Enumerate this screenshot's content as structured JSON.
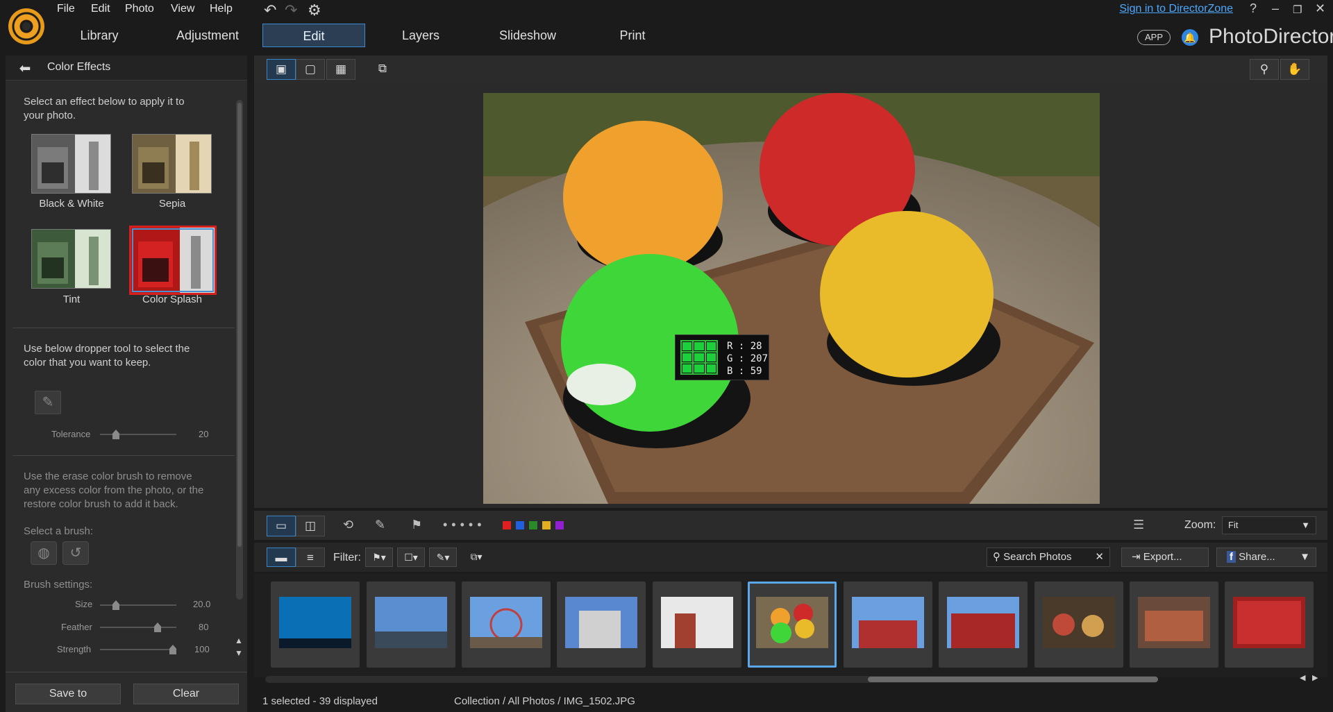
{
  "menu": [
    "File",
    "Edit",
    "Photo",
    "View",
    "Help"
  ],
  "tabs": [
    "Library",
    "Adjustment",
    "Edit",
    "Layers",
    "Slideshow",
    "Print"
  ],
  "active_tab": "Edit",
  "account": {
    "signin": "Sign in to DirectorZone",
    "help": "?"
  },
  "brand": {
    "app_badge": "APP",
    "name": "PhotoDirector"
  },
  "panel": {
    "title": "Color Effects",
    "intro": "Select an effect below to apply it to your photo.",
    "effects": [
      "Black & White",
      "Sepia",
      "Tint",
      "Color Splash"
    ],
    "selected_effect": "Color Splash",
    "dropper_text": "Use below dropper tool to select the color that you want to keep.",
    "tolerance": {
      "label": "Tolerance",
      "value": "20",
      "level": 0.25
    },
    "erase_text": "Use the erase color brush to remove any excess color from the photo, or the restore color brush to add it back.",
    "select_brush": "Select a brush:",
    "brush_settings": "Brush settings:",
    "size": {
      "label": "Size",
      "value": "20.0",
      "level": 0.2
    },
    "feather": {
      "label": "Feather",
      "value": "80",
      "level": 0.8
    },
    "strength": {
      "label": "Strength",
      "value": "100",
      "level": 1.0
    },
    "save_label": "Save to",
    "clear_label": "Clear"
  },
  "color_info": {
    "r": "R : 28",
    "g": "G : 207",
    "b": "B : 59",
    "swatch": "#1ccf3b"
  },
  "zoom": {
    "label": "Zoom:",
    "value": "Fit"
  },
  "filter": {
    "label": "Filter:"
  },
  "search": {
    "placeholder": "Search Photos"
  },
  "export_label": "Export...",
  "share_label": "Share...",
  "label_colors": [
    "#e02020",
    "#2060e0",
    "#2a8a2a",
    "#e0b020",
    "#9020d0"
  ],
  "thumbnails": 11,
  "selected_thumbnail": 6,
  "status": {
    "selection": "1 selected - 39 displayed",
    "path": "Collection / All Photos / IMG_1502.JPG"
  }
}
